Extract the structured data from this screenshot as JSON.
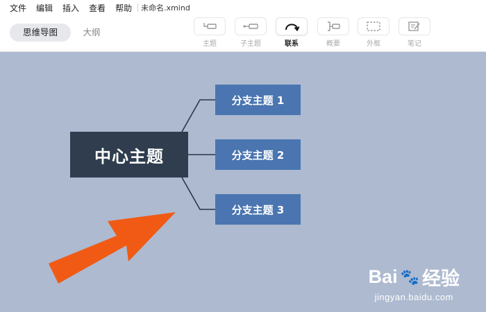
{
  "menubar": {
    "items": [
      "文件",
      "编辑",
      "插入",
      "查看",
      "帮助"
    ],
    "file_name": "未命名.xmind"
  },
  "view_tabs": {
    "mindmap": "思维导图",
    "outline": "大纲"
  },
  "tools": [
    {
      "label": "主题",
      "icon": "topic-icon"
    },
    {
      "label": "子主题",
      "icon": "subtopic-icon"
    },
    {
      "label": "联系",
      "icon": "relationship-icon",
      "active": true
    },
    {
      "label": "概要",
      "icon": "summary-icon"
    },
    {
      "label": "外框",
      "icon": "boundary-icon"
    },
    {
      "label": "笔记",
      "icon": "note-icon"
    }
  ],
  "mindmap": {
    "central": "中心主题",
    "branches": [
      "分支主题 1",
      "分支主题 2",
      "分支主题 3"
    ]
  },
  "watermark": {
    "logo_left": "Bai",
    "logo_right": "经验",
    "url": "jingyan.baidu.com"
  },
  "colors": {
    "canvas": "#adbad0",
    "central": "#2f3d4f",
    "branch": "#4a75b0",
    "arrow": "#f05a14"
  }
}
